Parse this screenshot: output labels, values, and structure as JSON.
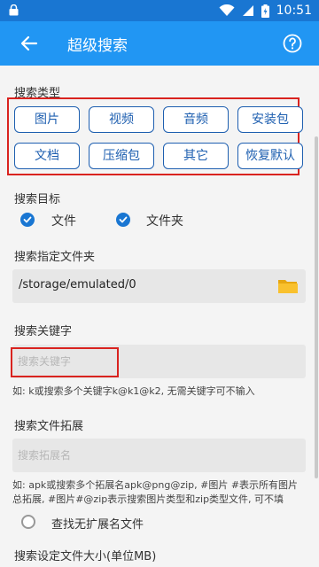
{
  "status_bar": {
    "time": "10:51"
  },
  "app_bar": {
    "title": "超级搜索"
  },
  "search_type": {
    "label": "搜索类型",
    "buttons": [
      "图片",
      "视频",
      "音频",
      "安装包",
      "文档",
      "压缩包",
      "其它",
      "恢复默认"
    ]
  },
  "search_target": {
    "label": "搜索目标",
    "options": [
      "文件",
      "文件夹"
    ]
  },
  "folder": {
    "label": "搜索指定文件夹",
    "value": "/storage/emulated/0"
  },
  "keyword": {
    "label": "搜索关键字",
    "placeholder": "搜索关键字",
    "hint": "如: k或搜索多个关键字k@k1@k2, 无需关键字可不输入"
  },
  "extension": {
    "label": "搜索文件拓展",
    "placeholder": "搜索拓展名",
    "hint": "如: apk或搜索多个拓展名apk@png@zip, #图片 #表示所有图片总拓展, #图片#@zip表示搜索图片类型和zip类型文件, 可不填",
    "no_ext_label": "查找无扩展名文件"
  },
  "size": {
    "label": "搜索设定文件大小(单位MB)"
  },
  "colors": {
    "accent": "#2196f3",
    "statusbar": "#1976d2",
    "highlight": "#d9231f"
  }
}
